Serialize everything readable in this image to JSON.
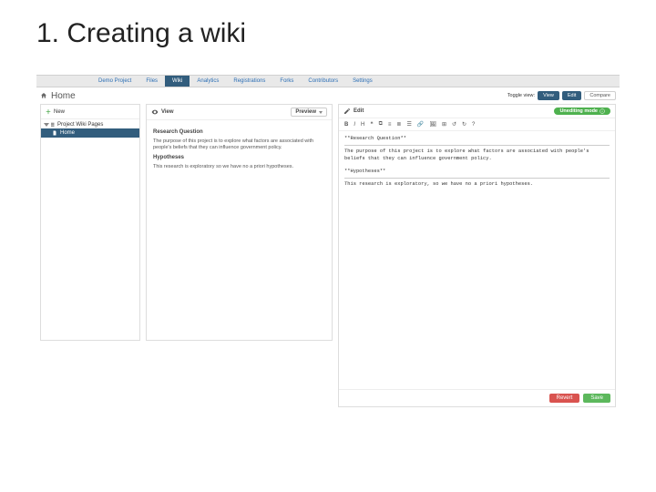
{
  "slide": {
    "title": "1. Creating a wiki"
  },
  "nav": {
    "items": [
      "Demo Project",
      "Files",
      "Wiki",
      "Analytics",
      "Registrations",
      "Forks",
      "Contributors",
      "Settings"
    ],
    "active": "Wiki"
  },
  "page": {
    "title": "Home",
    "toggles": {
      "viewer": "Toggle view:",
      "view": "View",
      "edit": "Edit",
      "compare": "Compare"
    }
  },
  "sidebar": {
    "new": "New",
    "root": "Project Wiki Pages",
    "items": [
      {
        "label": "Home",
        "active": true
      }
    ]
  },
  "viewPanel": {
    "title": "View",
    "previewLabel": "Preview",
    "heading1": "Research Question",
    "para1": "The purpose of this project is to explore what factors are associated with people's beliefs that they can influence government policy.",
    "heading2": "Hypotheses",
    "para2": "This research is exploratory so we have no a priori hypotheses."
  },
  "editPanel": {
    "title": "Edit",
    "badge": "Unediting mode ",
    "toolbar": [
      "B",
      "I",
      "H",
      "❝",
      "⧉",
      "≡",
      "≣",
      "☰",
      "🔗",
      "🖼",
      "⊞",
      "↺",
      "↻",
      "?"
    ],
    "content_l1": "**Research Question**",
    "content_l2": "The purpose of this project is to explore what factors are associated with people's beliefs that they can influence government policy.",
    "content_l3": "**Hypotheses**",
    "content_l4": "This research is exploratory, so we have no a priori hypotheses.",
    "revert": "Revert",
    "save": "Save"
  }
}
